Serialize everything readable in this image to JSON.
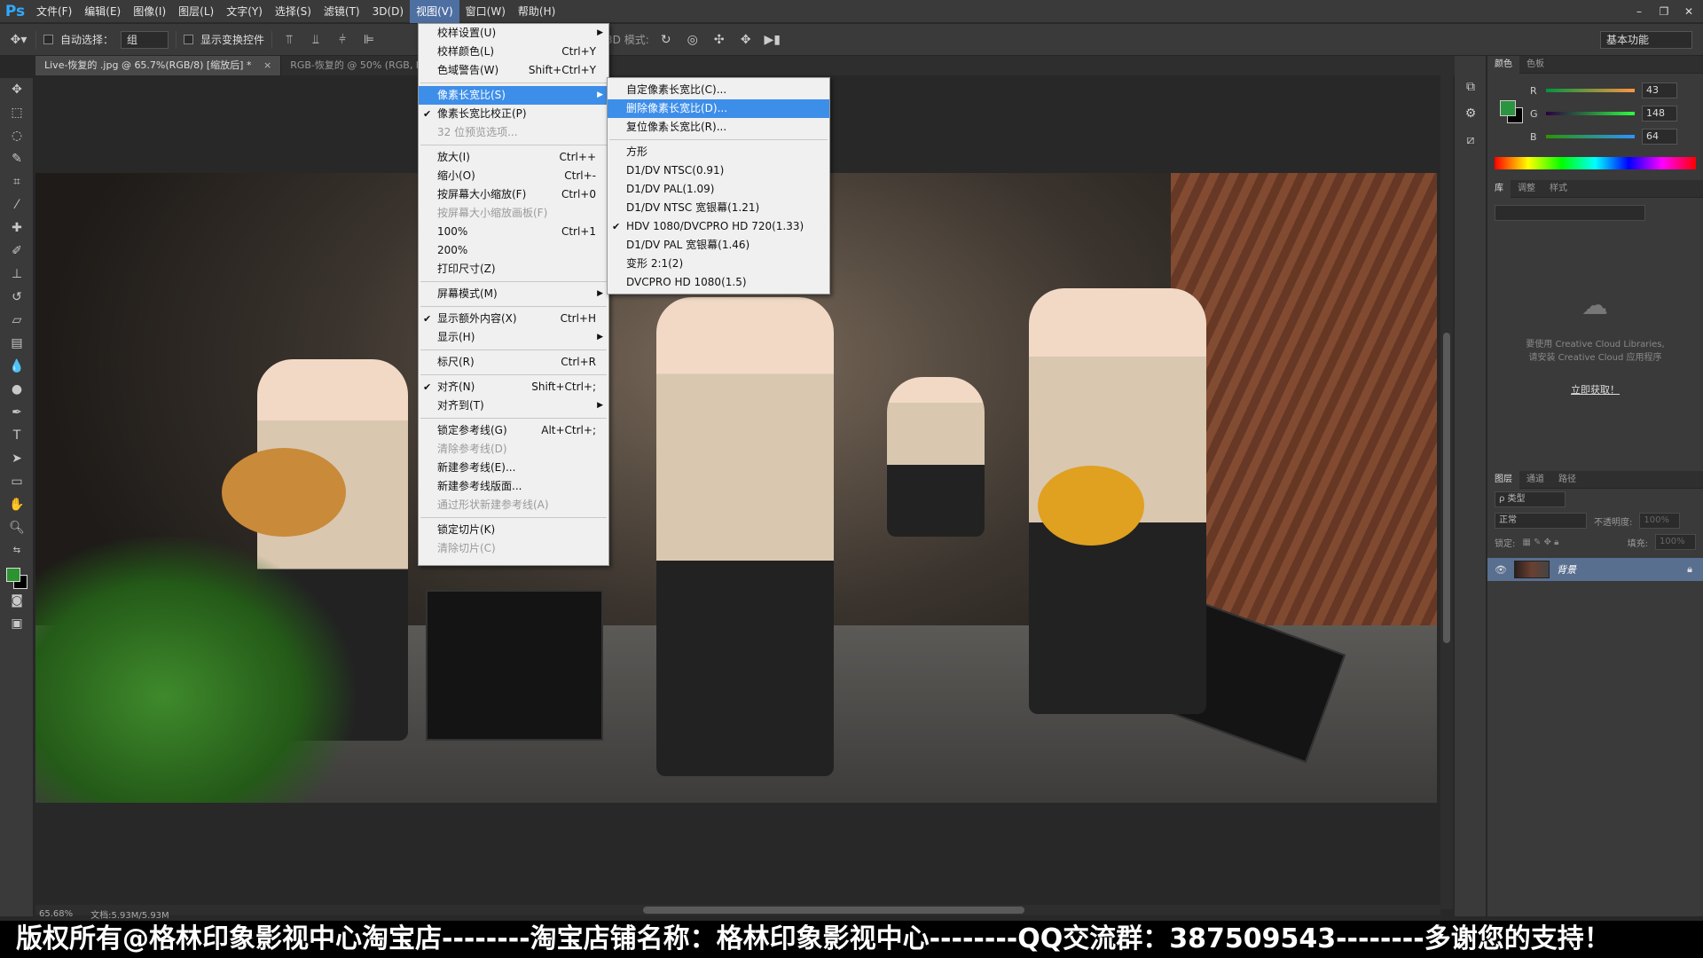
{
  "app": {
    "logo": "Ps",
    "menubar": [
      "文件(F)",
      "编辑(E)",
      "图像(I)",
      "图层(L)",
      "文字(Y)",
      "选择(S)",
      "滤镜(T)",
      "3D(D)",
      "视图(V)",
      "窗口(W)",
      "帮助(H)"
    ],
    "active_menu_index": 8,
    "window_controls": [
      "–",
      "❐",
      "✕"
    ]
  },
  "options": {
    "auto_select_label": "自动选择：",
    "auto_select_value": "组",
    "show_transform_label": "显示变换控件",
    "mode_3d_label": "3D 模式:",
    "workspace": "基本功能"
  },
  "tabs": [
    {
      "label": "Live-恢复的 .jpg @ 65.7%(RGB/8) [缩放后] *",
      "close": "×"
    },
    {
      "label": "RGB-恢复的 @ 50% (RGB, R",
      "close": ""
    }
  ],
  "view_menu": [
    {
      "label": "校样设置(U)",
      "shortcut": "",
      "submenu": true
    },
    {
      "label": "校样颜色(L)",
      "shortcut": "Ctrl+Y"
    },
    {
      "label": "色域警告(W)",
      "shortcut": "Shift+Ctrl+Y"
    },
    {
      "sep": true
    },
    {
      "label": "像素长宽比(S)",
      "shortcut": "",
      "submenu": true,
      "highlight": true
    },
    {
      "label": "像素长宽比校正(P)",
      "shortcut": "",
      "checked": true
    },
    {
      "label": "32 位预览选项...",
      "shortcut": "",
      "disabled": true
    },
    {
      "sep": true
    },
    {
      "label": "放大(I)",
      "shortcut": "Ctrl++"
    },
    {
      "label": "缩小(O)",
      "shortcut": "Ctrl+-"
    },
    {
      "label": "按屏幕大小缩放(F)",
      "shortcut": "Ctrl+0"
    },
    {
      "label": "按屏幕大小缩放画板(F)",
      "shortcut": "",
      "disabled": true
    },
    {
      "label": "100%",
      "shortcut": "Ctrl+1"
    },
    {
      "label": "200%",
      "shortcut": ""
    },
    {
      "label": "打印尺寸(Z)",
      "shortcut": ""
    },
    {
      "sep": true
    },
    {
      "label": "屏幕模式(M)",
      "shortcut": "",
      "submenu": true
    },
    {
      "sep": true
    },
    {
      "label": "显示额外内容(X)",
      "shortcut": "Ctrl+H",
      "checked": true
    },
    {
      "label": "显示(H)",
      "shortcut": "",
      "submenu": true
    },
    {
      "sep": true
    },
    {
      "label": "标尺(R)",
      "shortcut": "Ctrl+R"
    },
    {
      "sep": true
    },
    {
      "label": "对齐(N)",
      "shortcut": "Shift+Ctrl+;",
      "checked": true
    },
    {
      "label": "对齐到(T)",
      "shortcut": "",
      "submenu": true
    },
    {
      "sep": true
    },
    {
      "label": "锁定参考线(G)",
      "shortcut": "Alt+Ctrl+;"
    },
    {
      "label": "清除参考线(D)",
      "shortcut": "",
      "disabled": true
    },
    {
      "label": "新建参考线(E)...",
      "shortcut": ""
    },
    {
      "label": "新建参考线版面...",
      "shortcut": ""
    },
    {
      "label": "通过形状新建参考线(A)",
      "shortcut": "",
      "disabled": true
    },
    {
      "sep": true
    },
    {
      "label": "锁定切片(K)",
      "shortcut": ""
    },
    {
      "label": "清除切片(C)",
      "shortcut": "",
      "disabled": true
    }
  ],
  "sub_menu": [
    {
      "label": "自定像素长宽比(C)..."
    },
    {
      "label": "删除像素长宽比(D)...",
      "highlight": true
    },
    {
      "label": "复位像素长宽比(R)..."
    },
    {
      "sep": true
    },
    {
      "label": "方形"
    },
    {
      "label": "D1/DV NTSC(0.91)"
    },
    {
      "label": "D1/DV PAL(1.09)"
    },
    {
      "label": "D1/DV NTSC 宽银幕(1.21)"
    },
    {
      "label": "HDV 1080/DVCPRO HD 720(1.33)",
      "checked": true
    },
    {
      "label": "D1/DV PAL 宽银幕(1.46)"
    },
    {
      "label": "变形 2:1(2)"
    },
    {
      "label": "DVCPRO HD 1080(1.5)"
    }
  ],
  "color_panel": {
    "tabs": [
      "颜色",
      "色板"
    ],
    "r": "43",
    "g": "148",
    "b": "64",
    "fg_hex": "#2b9440"
  },
  "library_panel": {
    "tabs": [
      "库",
      "调整",
      "样式"
    ],
    "message_line1": "要使用 Creative Cloud Libraries,",
    "message_line2": "请安装 Creative Cloud 应用程序",
    "link": "立即获取！"
  },
  "layers_panel": {
    "tabs": [
      "图层",
      "通道",
      "路径"
    ],
    "filter": "ρ 类型",
    "blend_mode": "正常",
    "opacity_label": "不透明度:",
    "opacity_value": "100%",
    "lock_label": "锁定:",
    "fill_label": "填充:",
    "fill_value": "100%",
    "layer_name": "背景"
  },
  "status": {
    "zoom": "65.68%",
    "doc": "文档:5.93M/5.93M"
  },
  "banner": "版权所有@格林印象影视中心淘宝店--------淘宝店铺名称：格林印象影视中心--------QQ交流群：387509543--------多谢您的支持！"
}
